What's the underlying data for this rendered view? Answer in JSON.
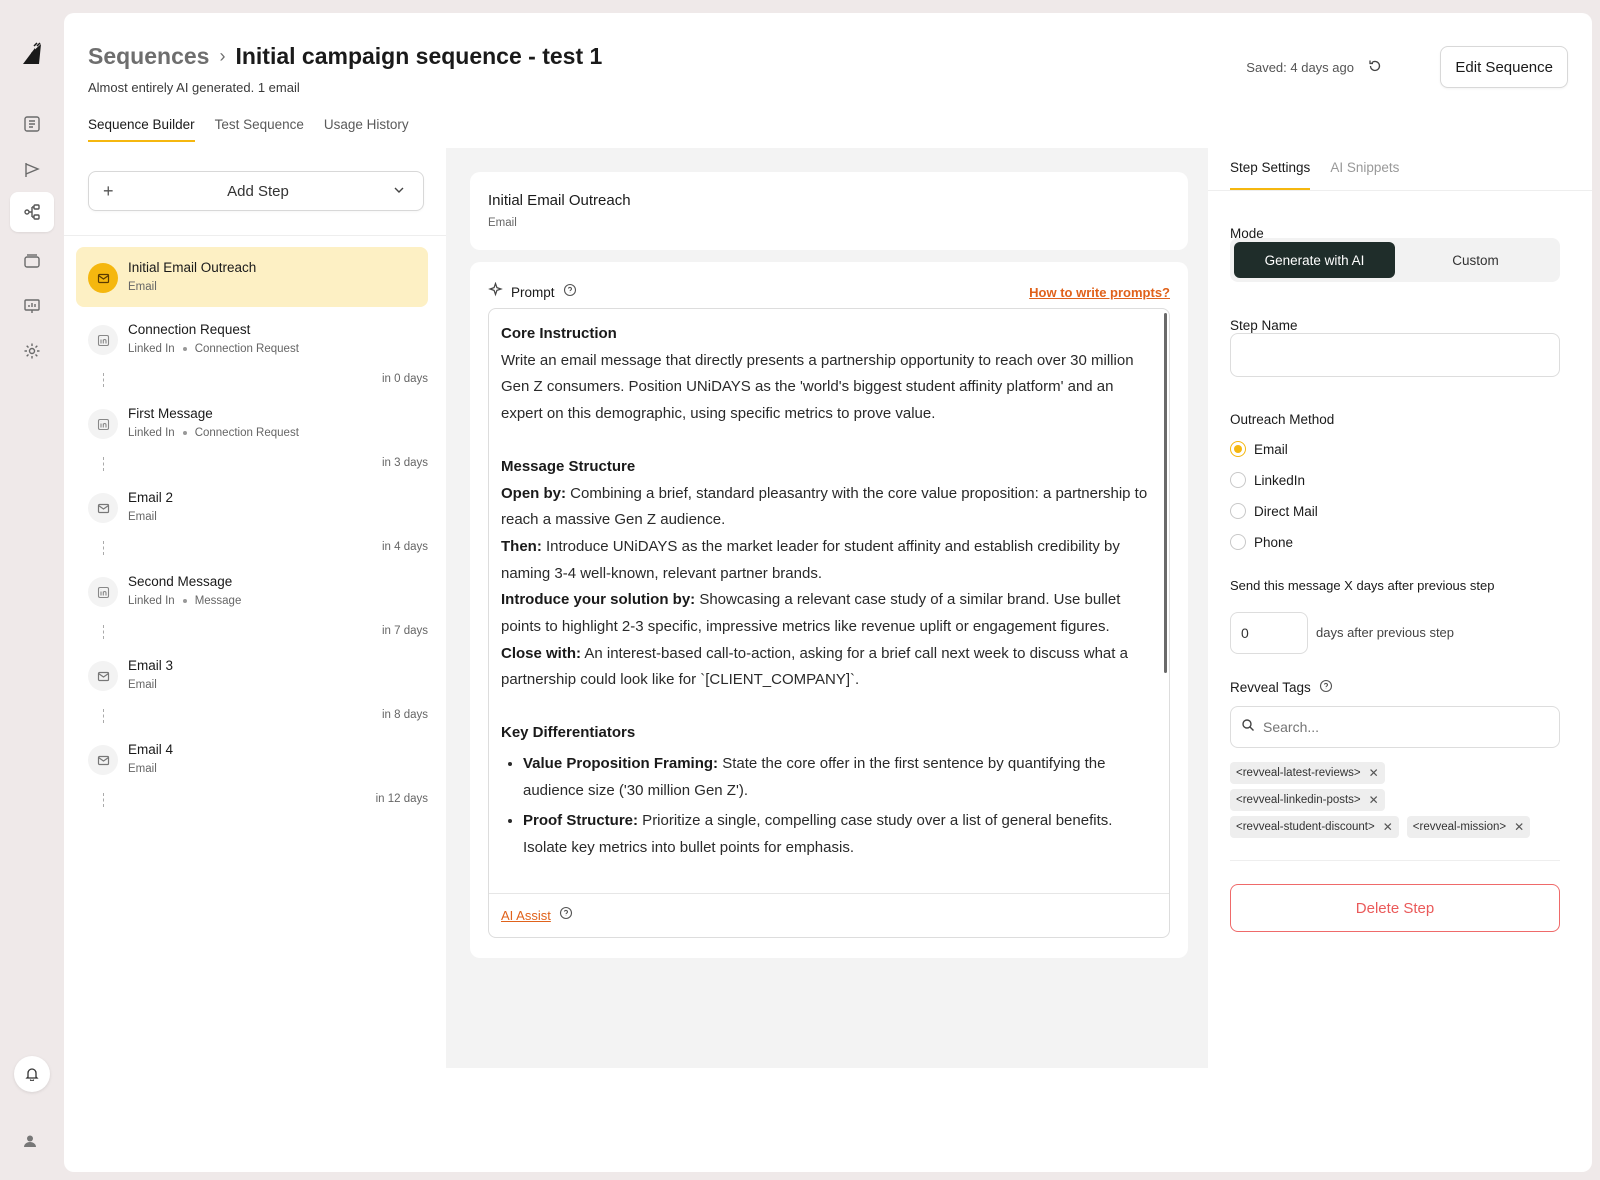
{
  "header": {
    "breadcrumb": "Sequences",
    "title": "Initial campaign sequence - test 1",
    "subtitle": "Almost entirely AI generated. 1 email",
    "saved": "Saved: 4 days ago",
    "edit_button": "Edit Sequence"
  },
  "tabs": [
    {
      "label": "Sequence Builder",
      "active": true
    },
    {
      "label": "Test Sequence",
      "active": false
    },
    {
      "label": "Usage History",
      "active": false
    }
  ],
  "left": {
    "add_step": "Add Step",
    "steps": [
      {
        "name": "Initial Email Outreach",
        "type": "Email",
        "subtype": "",
        "icon": "mail-icon",
        "active": true,
        "delay": ""
      },
      {
        "name": "Connection Request",
        "type": "Linked In",
        "subtype": "Connection Request",
        "icon": "linkedin-icon",
        "active": false,
        "delay": "in 0 days"
      },
      {
        "name": "First Message",
        "type": "Linked In",
        "subtype": "Connection Request",
        "icon": "linkedin-icon",
        "active": false,
        "delay": "in 3 days"
      },
      {
        "name": "Email 2",
        "type": "Email",
        "subtype": "",
        "icon": "mail-icon",
        "active": false,
        "delay": "in 4 days"
      },
      {
        "name": "Second Message",
        "type": "Linked In",
        "subtype": "Message",
        "icon": "linkedin-icon",
        "active": false,
        "delay": "in 7 days"
      },
      {
        "name": "Email 3",
        "type": "Email",
        "subtype": "",
        "icon": "mail-icon",
        "active": false,
        "delay": "in 8 days"
      },
      {
        "name": "Email 4",
        "type": "Email",
        "subtype": "",
        "icon": "mail-icon",
        "active": false,
        "delay": "in 12 days"
      }
    ],
    "trailing_delay": "in 12 days"
  },
  "middle": {
    "step_title": "Initial Email Outreach",
    "step_type": "Email",
    "prompt_label": "Prompt",
    "howto_link": "How to write prompts?",
    "ai_assist": "AI Assist",
    "prompt": {
      "core_heading": "Core Instruction",
      "core_text": "Write an email message that directly presents a partnership opportunity to reach over 30 million Gen Z consumers. Position UNiDAYS as the 'world's biggest student affinity platform' and an expert on this demographic, using specific metrics to prove value.",
      "structure_heading": "Message Structure",
      "structure": [
        {
          "lead": "Open by:",
          "text": " Combining a brief, standard pleasantry with the core value proposition: a partnership to reach a massive Gen Z audience."
        },
        {
          "lead": "Then:",
          "text": " Introduce UNiDAYS as the market leader for student affinity and establish credibility by naming 3-4 well-known, relevant partner brands."
        },
        {
          "lead": "Introduce your solution by:",
          "text": " Showcasing a relevant case study of a similar brand. Use bullet points to highlight 2-3 specific, impressive metrics like revenue uplift or engagement figures."
        },
        {
          "lead": "Close with:",
          "text": " An interest-based call-to-action, asking for a brief call next week to discuss what a partnership could look like for `[CLIENT_COMPANY]`."
        }
      ],
      "diff_heading": "Key Differentiators",
      "differentiators": [
        {
          "lead": "Value Proposition Framing:",
          "text": " State the core offer in the first sentence by quantifying the audience size ('30 million Gen Z')."
        },
        {
          "lead": "Proof Structure:",
          "text": " Prioritize a single, compelling case study over a list of general benefits. Isolate key metrics into bullet points for emphasis."
        }
      ]
    }
  },
  "right": {
    "tabs": [
      {
        "label": "Step Settings",
        "active": true
      },
      {
        "label": "AI Snippets",
        "active": false
      }
    ],
    "mode_label": "Mode",
    "mode_options": [
      "Generate with AI",
      "Custom"
    ],
    "mode_selected": "Generate with AI",
    "step_name_label": "Step Name",
    "step_name_value": "",
    "outreach_label": "Outreach Method",
    "outreach_options": [
      "Email",
      "LinkedIn",
      "Direct Mail",
      "Phone"
    ],
    "outreach_selected": "Email",
    "send_label": "Send this message X days after previous step",
    "days_value": "0",
    "days_after": "days after previous step",
    "tags_label": "Revveal Tags",
    "search_placeholder": "Search...",
    "tags": [
      "<revveal-latest-reviews>",
      "<revveal-linkedin-posts>",
      "<revveal-student-discount>",
      "<revveal-mission>"
    ],
    "delete_button": "Delete Step"
  },
  "colors": {
    "accent": "#f5b70f",
    "link": "#e0621b",
    "danger": "#ea5a5a",
    "segment_active": "#1f2d2a"
  }
}
